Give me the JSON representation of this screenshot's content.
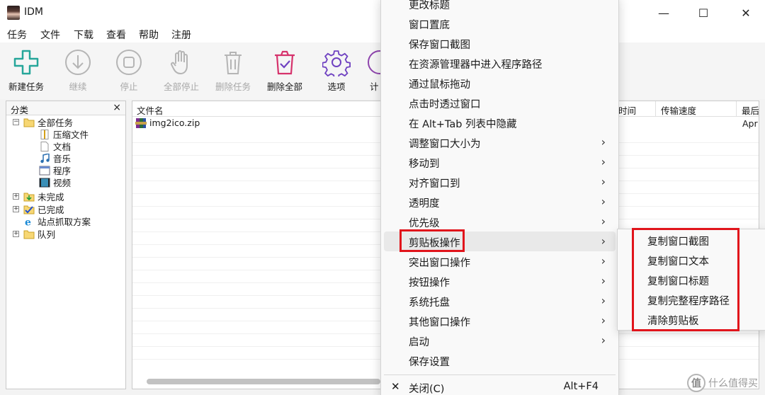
{
  "window": {
    "title": "IDM",
    "controls": {
      "minimize": "—",
      "maximize": "☐",
      "close": "✕"
    }
  },
  "menubar": [
    "任务",
    "文件",
    "下载",
    "查看",
    "帮助",
    "注册"
  ],
  "toolbar": [
    {
      "label": "新建任务",
      "icon": "plus-icon",
      "enabled": true,
      "color": "#26a69a"
    },
    {
      "label": "继续",
      "icon": "download-arrow-icon",
      "enabled": false
    },
    {
      "label": "停止",
      "icon": "stop-icon",
      "enabled": false
    },
    {
      "label": "全部停止",
      "icon": "hand-icon",
      "enabled": false
    },
    {
      "label": "删除任务",
      "icon": "trash-icon",
      "enabled": false
    },
    {
      "label": "删除全部",
      "icon": "trash-check-icon",
      "enabled": true,
      "color": "#d6336c"
    },
    {
      "label": "选项",
      "icon": "gear-icon",
      "enabled": true,
      "color": "#6f42c1"
    },
    {
      "label": "计",
      "icon": "scheduler-icon",
      "enabled": true,
      "color": "#8e44ad"
    }
  ],
  "sidebar": {
    "title": "分类",
    "close": "×",
    "items": [
      {
        "label": "全部任务",
        "icon": "folder-open-icon"
      },
      {
        "label": "压缩文件",
        "icon": "archive-icon"
      },
      {
        "label": "文档",
        "icon": "document-icon"
      },
      {
        "label": "音乐",
        "icon": "music-icon"
      },
      {
        "label": "程序",
        "icon": "program-icon"
      },
      {
        "label": "视频",
        "icon": "video-icon"
      },
      {
        "label": "未完成",
        "icon": "folder-download-icon"
      },
      {
        "label": "已完成",
        "icon": "folder-check-icon"
      },
      {
        "label": "站点抓取方案",
        "icon": "ie-icon"
      },
      {
        "label": "队列",
        "icon": "folder-icon"
      }
    ]
  },
  "list": {
    "columns": [
      "文件名",
      "时间",
      "传输速度",
      "最后"
    ],
    "rows": [
      {
        "name": "img2ico.zip",
        "last": "Apr"
      }
    ]
  },
  "context_menu": {
    "items": [
      {
        "label": "更改标题",
        "submenu": false
      },
      {
        "label": "窗口置底",
        "submenu": false
      },
      {
        "label": "保存窗口截图",
        "submenu": false
      },
      {
        "label": "在资源管理器中进入程序路径",
        "submenu": false
      },
      {
        "label": "通过鼠标拖动",
        "submenu": false
      },
      {
        "label": "点击时透过窗口",
        "submenu": false
      },
      {
        "label": "在 Alt+Tab 列表中隐藏",
        "submenu": false
      },
      {
        "label": "调整窗口大小为",
        "submenu": true
      },
      {
        "label": "移动到",
        "submenu": true
      },
      {
        "label": "对齐窗口到",
        "submenu": true
      },
      {
        "label": "透明度",
        "submenu": true
      },
      {
        "label": "优先级",
        "submenu": true
      },
      {
        "label": "剪贴板操作",
        "submenu": true,
        "highlighted": true
      },
      {
        "label": "突出窗口操作",
        "submenu": true
      },
      {
        "label": "按钮操作",
        "submenu": true
      },
      {
        "label": "系统托盘",
        "submenu": true
      },
      {
        "label": "其他窗口操作",
        "submenu": true
      },
      {
        "label": "启动",
        "submenu": true
      },
      {
        "label": "保存设置",
        "submenu": false
      }
    ],
    "close": {
      "label": "关闭(C)",
      "shortcut": "Alt+F4",
      "icon": "close-x-icon"
    }
  },
  "submenu": {
    "items": [
      "复制窗口截图",
      "复制窗口文本",
      "复制窗口标题",
      "复制完整程序路径",
      "清除剪贴板"
    ]
  },
  "watermark": {
    "logo": "值",
    "text": "什么值得买"
  },
  "colors": {
    "highlight_box": "#e1141b"
  }
}
